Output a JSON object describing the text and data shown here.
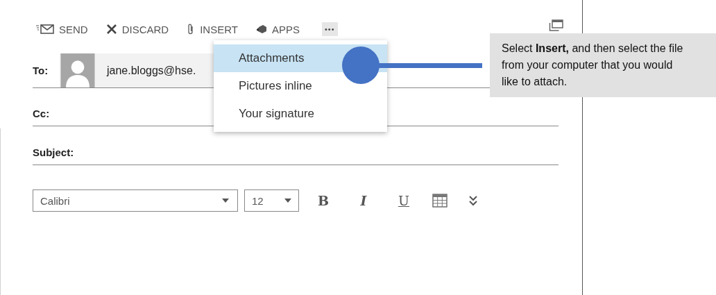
{
  "toolbar": [
    {
      "kind": "send",
      "label": "SEND"
    },
    {
      "kind": "discard",
      "label": "DISCARD"
    },
    {
      "kind": "insert",
      "label": "INSERT"
    },
    {
      "kind": "apps",
      "label": "APPS"
    },
    {
      "kind": "more",
      "label": "•••"
    }
  ],
  "menu": [
    {
      "label": "Attachments",
      "selected": true
    },
    {
      "label": "Pictures inline",
      "selected": false
    },
    {
      "label": "Your signature",
      "selected": false
    }
  ],
  "fields": [
    {
      "kind": "to",
      "label": "To:",
      "recipient": "jane.bloggs@hse."
    },
    {
      "kind": "plain",
      "label": "Cc:"
    },
    {
      "kind": "plain",
      "label": "Subject:"
    }
  ],
  "format": {
    "font": "Calibri",
    "size": "12",
    "buttons": [
      {
        "kind": "bold",
        "label": "B"
      },
      {
        "kind": "italic",
        "label": "I"
      },
      {
        "kind": "underline",
        "label": "U"
      },
      {
        "kind": "table"
      },
      {
        "kind": "more"
      }
    ]
  },
  "callout": {
    "text": "Select **Insert,** and then select the file from your computer that you would like to attach."
  }
}
